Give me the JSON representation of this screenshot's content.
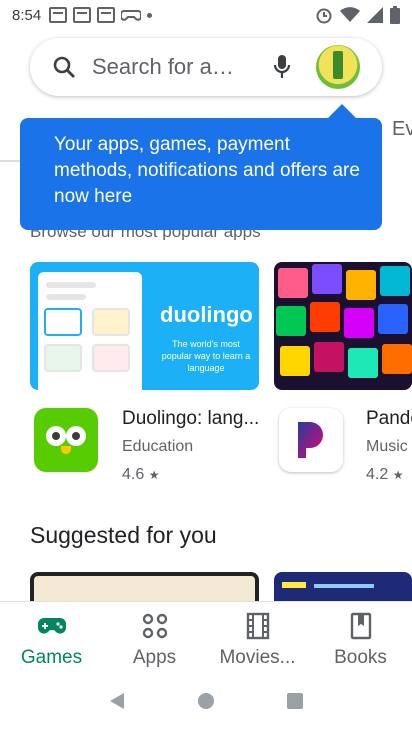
{
  "status_bar": {
    "time": "8:54",
    "icons": [
      "calendar-31-icon",
      "calendar-31-icon",
      "calendar-31-icon",
      "game-controller-icon",
      "dot-icon"
    ],
    "right_icons": [
      "alarm-icon",
      "wifi-icon",
      "signal-icon",
      "battery-icon"
    ]
  },
  "search": {
    "placeholder": "Search for apps & games",
    "display": "Search for ap..."
  },
  "top_tabs_peek": "Ev",
  "tooltip": {
    "text": "Your apps, games, payment methods, notifications and offers are now here"
  },
  "section_peek": "Browse our most popular apps",
  "popular_apps": [
    {
      "name": "Duolingo: lang...",
      "category": "Education",
      "rating": "4.6",
      "promo_title": "duolingo",
      "promo_sub": "The world's most popular way to learn a language"
    },
    {
      "name": "Pando",
      "category": "Music",
      "rating": "4.2"
    }
  ],
  "suggested": {
    "title": "Suggested for you"
  },
  "bottom_nav": {
    "items": [
      {
        "label": "Games",
        "icon": "games-icon",
        "active": true
      },
      {
        "label": "Apps",
        "icon": "apps-icon",
        "active": false
      },
      {
        "label": "Movies...",
        "icon": "movies-icon",
        "active": false
      },
      {
        "label": "Books",
        "icon": "books-icon",
        "active": false
      }
    ]
  },
  "colors": {
    "accent": "#01875f",
    "tooltip": "#1a73e8",
    "duolingo": "#58cc02"
  }
}
